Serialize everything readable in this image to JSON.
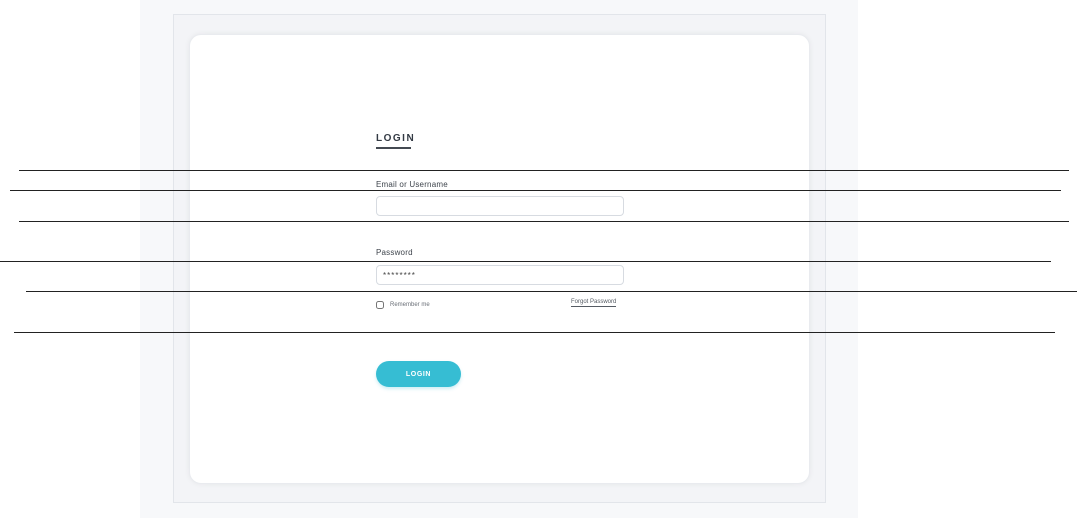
{
  "login_form": {
    "title": "LOGIN",
    "email_label": "Email or Username",
    "email_value": "",
    "password_label": "Password",
    "password_value": "********",
    "remember_label": "Remember me",
    "remember_checked": false,
    "forgot_link": "Forgot Password",
    "submit_label": "LOGIN"
  },
  "colors": {
    "accent": "#36bdd3",
    "background": "#f7f8fa",
    "card": "#ffffff",
    "text": "#333a44"
  }
}
